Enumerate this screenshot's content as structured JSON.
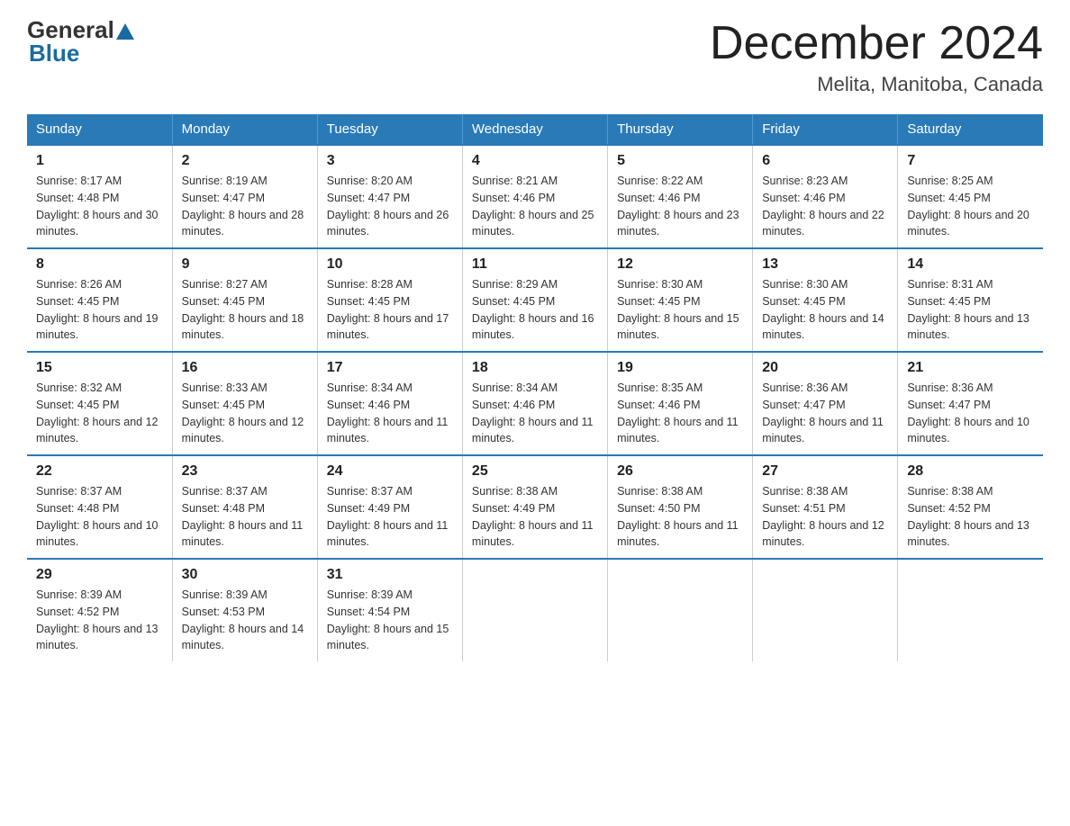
{
  "header": {
    "logo_general": "General",
    "logo_blue": "Blue",
    "month_title": "December 2024",
    "location": "Melita, Manitoba, Canada"
  },
  "days_of_week": [
    "Sunday",
    "Monday",
    "Tuesday",
    "Wednesday",
    "Thursday",
    "Friday",
    "Saturday"
  ],
  "weeks": [
    [
      {
        "day": "1",
        "sunrise": "8:17 AM",
        "sunset": "4:48 PM",
        "daylight": "8 hours and 30 minutes."
      },
      {
        "day": "2",
        "sunrise": "8:19 AM",
        "sunset": "4:47 PM",
        "daylight": "8 hours and 28 minutes."
      },
      {
        "day": "3",
        "sunrise": "8:20 AM",
        "sunset": "4:47 PM",
        "daylight": "8 hours and 26 minutes."
      },
      {
        "day": "4",
        "sunrise": "8:21 AM",
        "sunset": "4:46 PM",
        "daylight": "8 hours and 25 minutes."
      },
      {
        "day": "5",
        "sunrise": "8:22 AM",
        "sunset": "4:46 PM",
        "daylight": "8 hours and 23 minutes."
      },
      {
        "day": "6",
        "sunrise": "8:23 AM",
        "sunset": "4:46 PM",
        "daylight": "8 hours and 22 minutes."
      },
      {
        "day": "7",
        "sunrise": "8:25 AM",
        "sunset": "4:45 PM",
        "daylight": "8 hours and 20 minutes."
      }
    ],
    [
      {
        "day": "8",
        "sunrise": "8:26 AM",
        "sunset": "4:45 PM",
        "daylight": "8 hours and 19 minutes."
      },
      {
        "day": "9",
        "sunrise": "8:27 AM",
        "sunset": "4:45 PM",
        "daylight": "8 hours and 18 minutes."
      },
      {
        "day": "10",
        "sunrise": "8:28 AM",
        "sunset": "4:45 PM",
        "daylight": "8 hours and 17 minutes."
      },
      {
        "day": "11",
        "sunrise": "8:29 AM",
        "sunset": "4:45 PM",
        "daylight": "8 hours and 16 minutes."
      },
      {
        "day": "12",
        "sunrise": "8:30 AM",
        "sunset": "4:45 PM",
        "daylight": "8 hours and 15 minutes."
      },
      {
        "day": "13",
        "sunrise": "8:30 AM",
        "sunset": "4:45 PM",
        "daylight": "8 hours and 14 minutes."
      },
      {
        "day": "14",
        "sunrise": "8:31 AM",
        "sunset": "4:45 PM",
        "daylight": "8 hours and 13 minutes."
      }
    ],
    [
      {
        "day": "15",
        "sunrise": "8:32 AM",
        "sunset": "4:45 PM",
        "daylight": "8 hours and 12 minutes."
      },
      {
        "day": "16",
        "sunrise": "8:33 AM",
        "sunset": "4:45 PM",
        "daylight": "8 hours and 12 minutes."
      },
      {
        "day": "17",
        "sunrise": "8:34 AM",
        "sunset": "4:46 PM",
        "daylight": "8 hours and 11 minutes."
      },
      {
        "day": "18",
        "sunrise": "8:34 AM",
        "sunset": "4:46 PM",
        "daylight": "8 hours and 11 minutes."
      },
      {
        "day": "19",
        "sunrise": "8:35 AM",
        "sunset": "4:46 PM",
        "daylight": "8 hours and 11 minutes."
      },
      {
        "day": "20",
        "sunrise": "8:36 AM",
        "sunset": "4:47 PM",
        "daylight": "8 hours and 11 minutes."
      },
      {
        "day": "21",
        "sunrise": "8:36 AM",
        "sunset": "4:47 PM",
        "daylight": "8 hours and 10 minutes."
      }
    ],
    [
      {
        "day": "22",
        "sunrise": "8:37 AM",
        "sunset": "4:48 PM",
        "daylight": "8 hours and 10 minutes."
      },
      {
        "day": "23",
        "sunrise": "8:37 AM",
        "sunset": "4:48 PM",
        "daylight": "8 hours and 11 minutes."
      },
      {
        "day": "24",
        "sunrise": "8:37 AM",
        "sunset": "4:49 PM",
        "daylight": "8 hours and 11 minutes."
      },
      {
        "day": "25",
        "sunrise": "8:38 AM",
        "sunset": "4:49 PM",
        "daylight": "8 hours and 11 minutes."
      },
      {
        "day": "26",
        "sunrise": "8:38 AM",
        "sunset": "4:50 PM",
        "daylight": "8 hours and 11 minutes."
      },
      {
        "day": "27",
        "sunrise": "8:38 AM",
        "sunset": "4:51 PM",
        "daylight": "8 hours and 12 minutes."
      },
      {
        "day": "28",
        "sunrise": "8:38 AM",
        "sunset": "4:52 PM",
        "daylight": "8 hours and 13 minutes."
      }
    ],
    [
      {
        "day": "29",
        "sunrise": "8:39 AM",
        "sunset": "4:52 PM",
        "daylight": "8 hours and 13 minutes."
      },
      {
        "day": "30",
        "sunrise": "8:39 AM",
        "sunset": "4:53 PM",
        "daylight": "8 hours and 14 minutes."
      },
      {
        "day": "31",
        "sunrise": "8:39 AM",
        "sunset": "4:54 PM",
        "daylight": "8 hours and 15 minutes."
      },
      null,
      null,
      null,
      null
    ]
  ],
  "labels": {
    "sunrise": "Sunrise:",
    "sunset": "Sunset:",
    "daylight": "Daylight:"
  }
}
